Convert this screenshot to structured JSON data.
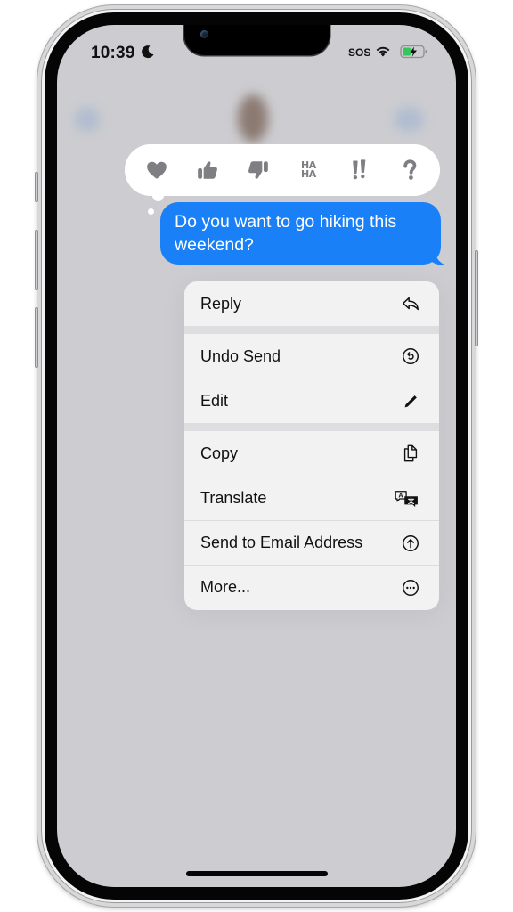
{
  "status_bar": {
    "time": "10:39",
    "focus_icon": "moon-icon",
    "carrier": "SOS",
    "wifi_icon": "wifi-icon",
    "battery_icon": "battery-charging-icon",
    "battery_color": "#34c759"
  },
  "tapbacks": [
    {
      "name": "heart",
      "icon": "heart-icon"
    },
    {
      "name": "thumbs-up",
      "icon": "thumbs-up-icon"
    },
    {
      "name": "thumbs-down",
      "icon": "thumbs-down-icon"
    },
    {
      "name": "haha",
      "icon": "haha-icon",
      "label_top": "HA",
      "label_bottom": "HA"
    },
    {
      "name": "exclamation",
      "icon": "double-exclamation-icon",
      "label": "!!"
    },
    {
      "name": "question",
      "icon": "question-icon",
      "label": "?"
    }
  ],
  "message": {
    "text": "Do you want to go hiking this weekend?",
    "bubble_color": "#1a80f8"
  },
  "menu": {
    "groups": [
      [
        {
          "label": "Reply",
          "icon": "reply-icon"
        }
      ],
      [
        {
          "label": "Undo Send",
          "icon": "undo-circle-icon"
        },
        {
          "label": "Edit",
          "icon": "pencil-icon"
        }
      ],
      [
        {
          "label": "Copy",
          "icon": "copy-icon"
        },
        {
          "label": "Translate",
          "icon": "translate-icon"
        },
        {
          "label": "Send to Email Address",
          "icon": "arrow-up-circle-icon"
        },
        {
          "label": "More...",
          "icon": "ellipsis-circle-icon"
        }
      ]
    ]
  }
}
